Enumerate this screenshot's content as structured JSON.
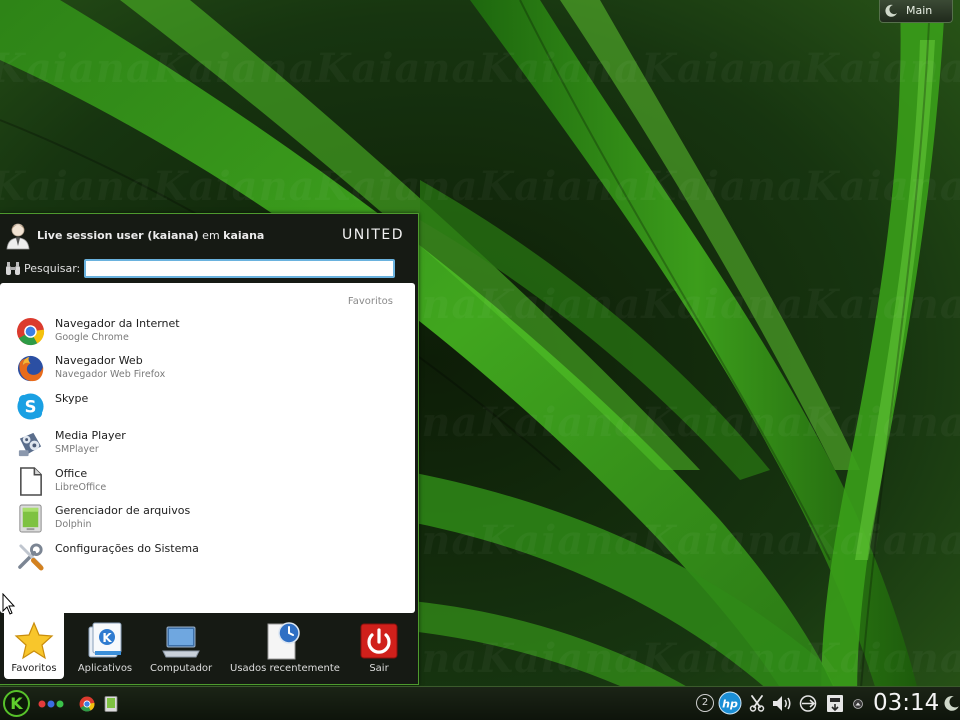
{
  "activity": {
    "label": "Main",
    "icon": "moon-icon"
  },
  "launcher": {
    "user_name": "Live session user (kaiana)",
    "connector": "em",
    "host": "kaiana",
    "hostname_display": "UNITED",
    "search": {
      "label": "Pesquisar:",
      "value": "",
      "placeholder": ""
    },
    "section_title": "Favoritos",
    "favorites": [
      {
        "name": "Navegador da Internet",
        "desc": "Google Chrome",
        "icon": "chrome-icon"
      },
      {
        "name": "Navegador Web",
        "desc": "Navegador Web Firefox",
        "icon": "firefox-icon"
      },
      {
        "name": "Skype",
        "desc": "",
        "icon": "skype-icon"
      },
      {
        "name": "Media Player",
        "desc": "SMPlayer",
        "icon": "smplayer-icon"
      },
      {
        "name": "Office",
        "desc": "LibreOffice",
        "icon": "libreoffice-icon"
      },
      {
        "name": "Gerenciador de arquivos",
        "desc": "Dolphin",
        "icon": "dolphin-icon"
      },
      {
        "name": "Configurações do Sistema",
        "desc": "",
        "icon": "system-settings-icon"
      }
    ],
    "tabs": [
      {
        "label": "Favoritos",
        "icon": "star-icon",
        "active": true
      },
      {
        "label": "Aplicativos",
        "icon": "applications-icon",
        "active": false
      },
      {
        "label": "Computador",
        "icon": "computer-icon",
        "active": false
      },
      {
        "label": "Usados recentemente",
        "icon": "recent-documents-icon",
        "active": false
      },
      {
        "label": "Sair",
        "icon": "power-icon",
        "active": false
      }
    ]
  },
  "taskbar": {
    "start_icon": "kaiana-k-icon",
    "pager_icon": "activity-dots-icon",
    "launchers": [
      "chrome-icon",
      "file-manager-icon"
    ],
    "tray": {
      "notification_count": "2",
      "icons": [
        "hp-icon",
        "scissors-icon",
        "volume-icon",
        "network-icon",
        "device-notifier-icon",
        "tray-expand-icon"
      ]
    },
    "clock": "03:14"
  },
  "colors": {
    "accent": "#4e9a2e",
    "panel_bg": "#161a14",
    "content_bg": "#ffffff",
    "search_border": "#6ab2de",
    "power_red": "#d0201b"
  }
}
